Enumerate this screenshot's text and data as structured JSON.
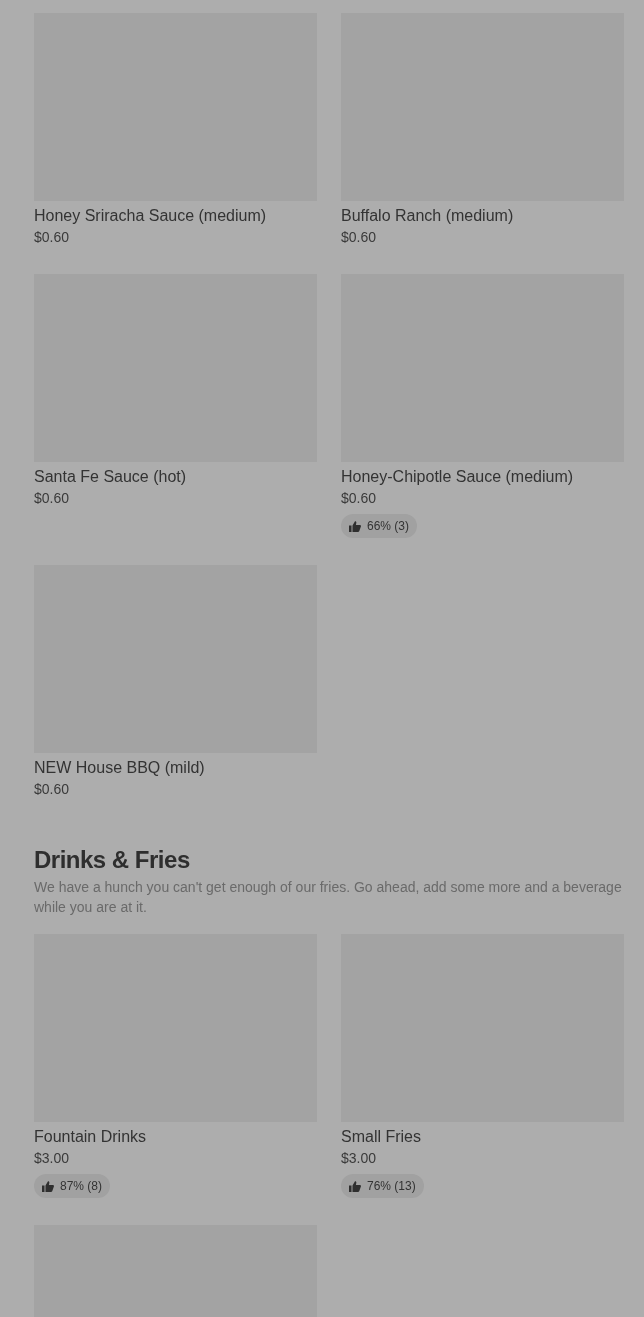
{
  "sections": [
    {
      "items": [
        {
          "kind": "full",
          "name": "Honey Sriracha Sauce (medium)",
          "price": "$0.60"
        },
        {
          "kind": "full",
          "name": "Buffalo Ranch (medium)",
          "price": "$0.60"
        },
        {
          "kind": "full",
          "name": "Santa Fe Sauce (hot)",
          "price": "$0.60"
        },
        {
          "kind": "full",
          "name": "Honey-Chipotle Sauce (medium)",
          "price": "$0.60",
          "rating": "66% (3)"
        },
        {
          "kind": "full",
          "name": "NEW House BBQ (mild)",
          "price": "$0.60"
        }
      ]
    },
    {
      "title": "Drinks & Fries",
      "description": "We have a hunch you can't get enough of our fries. Go ahead, add some more and a beverage while you are at it.",
      "items": [
        {
          "kind": "full",
          "name": "Fountain Drinks",
          "price": "$3.00",
          "rating": "87% (8)"
        },
        {
          "kind": "full",
          "name": "Small Fries",
          "price": "$3.00",
          "rating": "76% (13)"
        },
        {
          "kind": "image_only"
        }
      ]
    }
  ]
}
